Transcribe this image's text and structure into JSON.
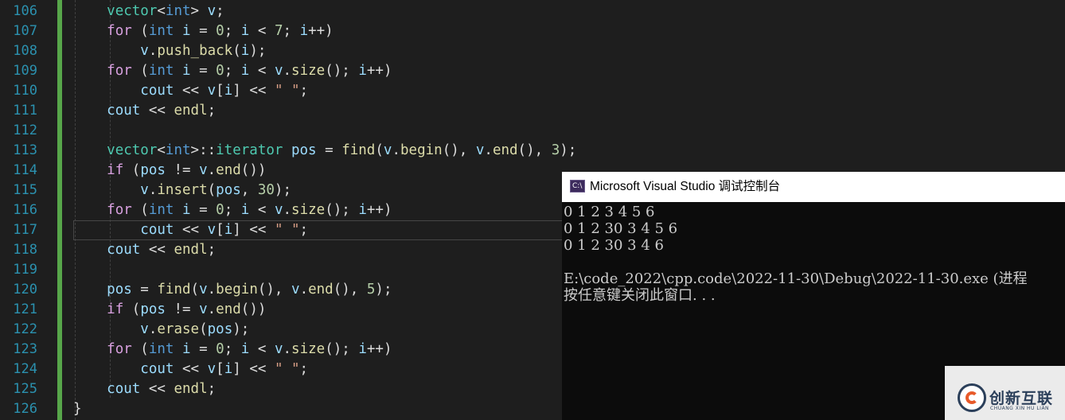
{
  "editor": {
    "line_numbers": [
      "106",
      "107",
      "108",
      "109",
      "110",
      "111",
      "112",
      "113",
      "114",
      "115",
      "116",
      "117",
      "118",
      "119",
      "120",
      "121",
      "122",
      "123",
      "124",
      "125",
      "126"
    ],
    "literals": {
      "zero": "0",
      "seven": "7",
      "three": "3",
      "thirty": "30",
      "five": "5",
      "space_str": "\" \""
    }
  },
  "console": {
    "title": "Microsoft Visual Studio 调试控制台",
    "icon_label": "C:\\",
    "output_lines": [
      "0 1 2 3 4 5 6",
      "0 1 2 30 3 4 5 6",
      "0 1 2 30 3 4 6",
      "",
      "E:\\code_2022\\cpp.code\\2022-11-30\\Debug\\2022-11-30.exe (进程",
      "按任意键关闭此窗口. . ."
    ]
  },
  "watermark": {
    "brand": "创新互联",
    "subtitle": "CHUANG XIN HU LIAN"
  },
  "colors": {
    "background": "#1e1e1e",
    "line_number": "#2b91af",
    "keyword": "#569cd6",
    "control_keyword": "#d8a0df",
    "type": "#4ec9b0",
    "variable": "#9cdcfe",
    "function": "#dcdcaa",
    "number": "#b5cea8",
    "string": "#d69d85",
    "change_bar": "#57a64a"
  }
}
